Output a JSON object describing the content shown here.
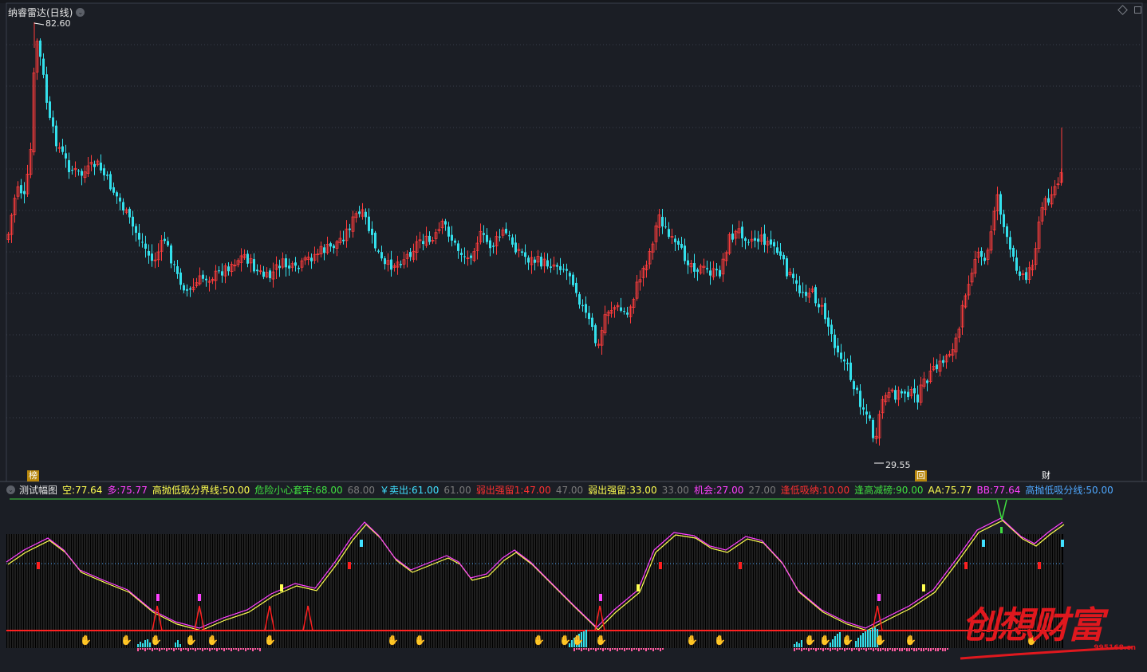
{
  "main_chart": {
    "title": "纳睿雷达(日线)",
    "high_label": "82.60",
    "low_label": "29.55",
    "markers": [
      "榜",
      "回",
      "财"
    ],
    "colors": {
      "up": "#ff3c3c",
      "down": "#33e0ec",
      "background": "#1b1e25",
      "grid": "#3a3f4a"
    }
  },
  "indicator": {
    "title": "测试幅图",
    "legend": [
      {
        "label": "空:",
        "value": "77.64",
        "color": "#ffff50"
      },
      {
        "label": "多:",
        "value": "75.77",
        "color": "#ff40ff"
      },
      {
        "label": "高抛低吸分界线:",
        "value": "50.00",
        "color": "#ffff50"
      },
      {
        "label": "危险小心套牢:",
        "value": "68.00",
        "color": "#40e040"
      },
      {
        "label": "",
        "value": "68.00",
        "color": "#7a7a7a"
      },
      {
        "label": "￥卖出:",
        "value": "61.00",
        "color": "#40e0ff"
      },
      {
        "label": "",
        "value": "61.00",
        "color": "#7a7a7a"
      },
      {
        "label": "弱出强留1:",
        "value": "47.00",
        "color": "#ff3030"
      },
      {
        "label": "",
        "value": "47.00",
        "color": "#7a7a7a"
      },
      {
        "label": "弱出强留:",
        "value": "33.00",
        "color": "#ffff50"
      },
      {
        "label": "",
        "value": "33.00",
        "color": "#7a7a7a"
      },
      {
        "label": "机会:",
        "value": "27.00",
        "color": "#ff40ff"
      },
      {
        "label": "",
        "value": "27.00",
        "color": "#7a7a7a"
      },
      {
        "label": "逢低吸纳:",
        "value": "10.00",
        "color": "#ff3030"
      },
      {
        "label": "逢高减磅:",
        "value": "90.00",
        "color": "#40e040"
      },
      {
        "label": "AA:",
        "value": "75.77",
        "color": "#ffff50"
      },
      {
        "label": "BB:",
        "value": "77.64",
        "color": "#ff40ff"
      },
      {
        "label": "高抛低吸分线:",
        "value": "50.00",
        "color": "#4fa8ff"
      }
    ]
  },
  "watermark": {
    "text": "创想财富",
    "url": "995168.cn"
  },
  "icons": [
    "chevron-down-icon",
    "window-restore-icon",
    "diamond-icon",
    "hand-pointer-icon"
  ]
}
